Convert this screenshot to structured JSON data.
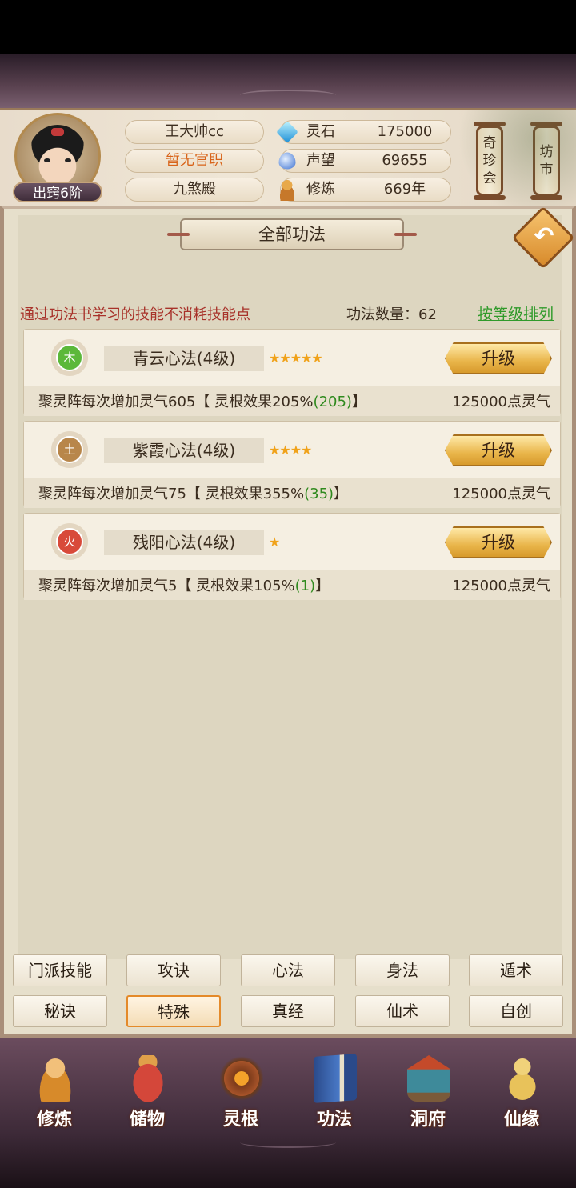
{
  "player": {
    "name": "王大帅cc",
    "title": "暂无官职",
    "sect": "九煞殿",
    "rank": "出窍6阶"
  },
  "resources": [
    {
      "label": "灵石",
      "value": "175000",
      "icon": "spirit-stone-icon"
    },
    {
      "label": "声望",
      "value": "69655",
      "icon": "reputation-icon"
    },
    {
      "label": "修炼",
      "value": "669年",
      "icon": "cultivation-icon"
    }
  ],
  "shortcuts": {
    "treasure": "奇\n珍\n会",
    "market": "坊\n市"
  },
  "panel": {
    "title": "全部功法",
    "hint": "通过功法书学习的技能不消耗技能点",
    "count_label": "功法数量：62",
    "sort_link": "按等级排列"
  },
  "skills": [
    {
      "element": "木",
      "element_color": "#5cb83a",
      "name": "青云心法(4级)",
      "stars": "★★★★★",
      "button": "升级",
      "effect_prefix": "聚灵阵每次增加灵气605【 灵根效果205%",
      "effect_bonus": "(205)",
      "effect_suffix": "】",
      "cost": "125000点灵气"
    },
    {
      "element": "土",
      "element_color": "#b8864a",
      "name": "紫霞心法(4级)",
      "stars": "★★★★",
      "button": "升级",
      "effect_prefix": "聚灵阵每次增加灵气75【 灵根效果355%",
      "effect_bonus": "(35)",
      "effect_suffix": "】",
      "cost": "125000点灵气"
    },
    {
      "element": "火",
      "element_color": "#d84a3a",
      "name": "残阳心法(4级)",
      "stars": "★",
      "button": "升级",
      "effect_prefix": "聚灵阵每次增加灵气5【 灵根效果105%",
      "effect_bonus": "(1)",
      "effect_suffix": "】",
      "cost": "125000点灵气"
    }
  ],
  "tabs": [
    "门派技能",
    "攻诀",
    "心法",
    "身法",
    "遁术",
    "秘诀",
    "特殊",
    "真经",
    "仙术",
    "自创"
  ],
  "active_tab": "特殊",
  "nav": [
    "修炼",
    "储物",
    "灵根",
    "功法",
    "洞府",
    "仙缘"
  ]
}
